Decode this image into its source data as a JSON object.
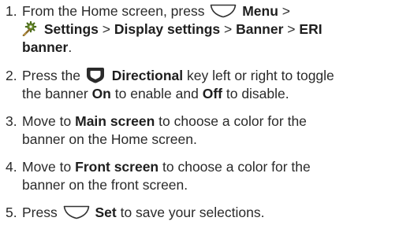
{
  "steps": [
    {
      "num": "1.",
      "line1_pre": "From the Home screen, press",
      "menu_icon": "menu-key-icon",
      "menu_label": "Menu",
      "sep_a": ">",
      "settings_icon": "settings-gear-icon",
      "settings_label": "Settings",
      "sep_b": ">",
      "display_label": "Display settings",
      "sep_c": ">",
      "banner_label": "Banner",
      "sep_d": ">",
      "eri_label": "ERI",
      "eri_label_2": "banner",
      "line3_post": "."
    },
    {
      "num": "2.",
      "pre": "Press the",
      "dpad_icon": "directional-key-icon",
      "key_label": "Directional",
      "mid": "key left or right to toggle",
      "line2_pre": "the banner",
      "on_label": "On",
      "line2_mid": "to enable and",
      "off_label": "Off",
      "line2_post": "to disable."
    },
    {
      "num": "3.",
      "pre": "Move to",
      "target_label": "Main screen",
      "post": "to choose a color for the",
      "line2": "banner on the Home screen."
    },
    {
      "num": "4.",
      "pre": "Move to",
      "target_label": "Front screen",
      "post": "to choose a color for the",
      "line2": "banner on the front screen."
    },
    {
      "num": "5.",
      "pre": "Press",
      "set_icon": "set-key-icon",
      "set_label": "Set",
      "post": "to save your selections."
    }
  ]
}
